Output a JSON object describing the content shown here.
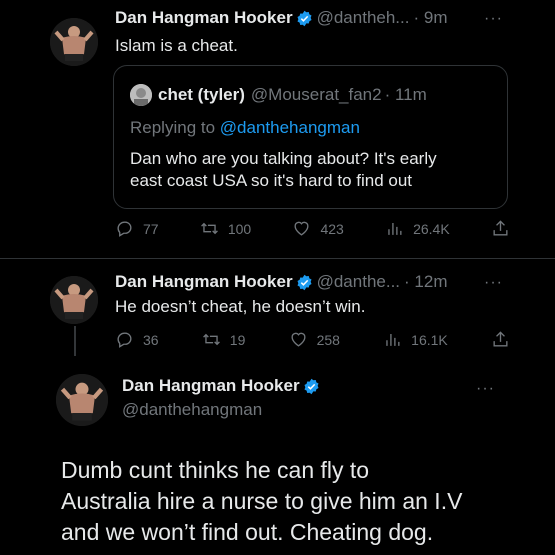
{
  "tweets": [
    {
      "author_name": "Dan Hangman Hooker",
      "handle": "@dantheh...",
      "time": "· 9m",
      "text": "Islam is a cheat.",
      "quote": {
        "author_name": "chet (tyler)",
        "handle": "@Mouserat_fan2",
        "time": "· 11m",
        "replying_prefix": "Replying to",
        "replying_to": "@danthehangman",
        "text_line1": "Dan who are you talking about? It's early",
        "text_line2": "east coast USA so it's hard to find out"
      },
      "stats": {
        "replies": "77",
        "retweets": "100",
        "likes": "423",
        "views": "26.4K"
      }
    },
    {
      "author_name": "Dan Hangman Hooker",
      "handle": "@danthe...",
      "time": "· 12m",
      "text": "He doesn’t cheat, he doesn’t win.",
      "stats": {
        "replies": "36",
        "retweets": "19",
        "likes": "258",
        "views": "16.1K"
      }
    }
  ],
  "main": {
    "author_name": "Dan Hangman Hooker",
    "handle": "@danthehangman",
    "text_line1": "Dumb cunt thinks he can fly to",
    "text_line2": "Australia hire a nurse to give him an I.V",
    "text_line3": "and we won’t find out. Cheating dog."
  },
  "more_glyph": "···",
  "colors": {
    "verified": "#1d9bf0",
    "link": "#1d9bf0",
    "muted": "#71767b",
    "background": "#000000"
  }
}
